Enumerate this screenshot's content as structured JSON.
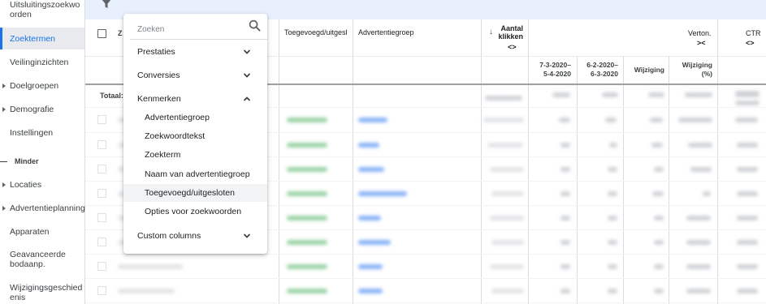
{
  "sidebar": {
    "items": [
      {
        "label": "Uitsluitingszoekwo orden",
        "active": false,
        "expandable": false
      },
      {
        "label": "Zoektermen",
        "active": true,
        "expandable": false
      },
      {
        "label": "Veilinginzichten",
        "active": false,
        "expandable": false
      },
      {
        "label": "Doelgroepen",
        "active": false,
        "expandable": true
      },
      {
        "label": "Demografie",
        "active": false,
        "expandable": true
      },
      {
        "label": "Instellingen",
        "active": false,
        "expandable": false
      },
      {
        "label": "Locaties",
        "active": false,
        "expandable": true
      },
      {
        "label": "Advertentieplanning",
        "active": false,
        "expandable": true
      },
      {
        "label": "Apparaten",
        "active": false,
        "expandable": false
      },
      {
        "label": "Geavanceerde bodaanp.",
        "active": false,
        "expandable": false
      },
      {
        "label": "Wijzigingsgeschied enis",
        "active": false,
        "expandable": false
      }
    ],
    "less_label": "Minder"
  },
  "toolbar": {
    "filter_icon": "filter-icon"
  },
  "table": {
    "headers": {
      "col_z": "Z",
      "toegevoegd": "Toegevoegd/uitgesl",
      "advertentiegroep": "Advertentiegroep",
      "aantal_klikken": "Aantal klikken",
      "verton": "Verton.",
      "ctr": "CTR"
    },
    "sub_headers": {
      "period_current": "7-3-2020– 5-4-2020",
      "period_previous": "6-2-2020– 6-3-2020",
      "wijziging": "Wijziging",
      "wijziging_pct": "Wijziging (%)"
    },
    "totaal_label": "Totaal: Z",
    "sort_arrow": "↓",
    "expand_glyph": "<>",
    "collapse_glyph": "><"
  },
  "dropdown": {
    "search_placeholder": "Zoeken",
    "sections": [
      {
        "label": "Prestaties",
        "expanded": false
      },
      {
        "label": "Conversies",
        "expanded": false
      },
      {
        "label": "Kenmerken",
        "expanded": true
      },
      {
        "label": "Custom columns",
        "expanded": false
      }
    ],
    "kenmerken_items": [
      "Advertentiegroep",
      "Zoekwoordtekst",
      "Zoekterm",
      "Naam van advertentiegroep",
      "Toegevoegd/uitgesloten",
      "Opties voor zoekwoorden"
    ],
    "hovered_item": "Toegevoegd/uitgesloten"
  },
  "colors": {
    "accent": "#1a73e8",
    "toolbar_bg": "#e8f0fe",
    "active_item_bg": "#e8eaed"
  }
}
